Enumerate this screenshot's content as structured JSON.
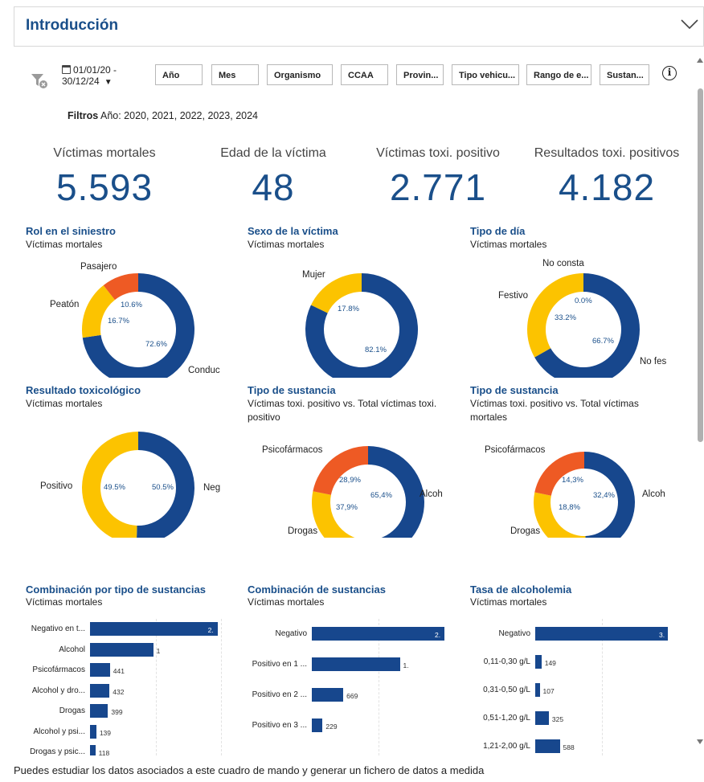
{
  "accordion": {
    "title": "Introducción",
    "chevron_icon": "chevron-down-icon"
  },
  "toolbar": {
    "filter_icon": "filter-clear-icon",
    "date_line1": "01/01/20 -",
    "date_line2": "30/12/24",
    "slicers": [
      "Año",
      "Mes",
      "Organismo",
      "CCAA",
      "Provin...",
      "Tipo vehicu...",
      "Rango de e...",
      "Sustan..."
    ],
    "info_icon": "info-icon"
  },
  "filters": {
    "label": "Filtros",
    "text": "Año: 2020, 2021, 2022, 2023, 2024"
  },
  "kpis": [
    {
      "label": "Víctimas mortales",
      "value": "5.593"
    },
    {
      "label": "Edad de la víctima",
      "value": "48"
    },
    {
      "label": "Víctimas toxi. positivo",
      "value": "2.771"
    },
    {
      "label": "Resultados toxi. positivos",
      "value": "4.182"
    }
  ],
  "colors": {
    "blue": "#17478d",
    "yellow": "#fcc300",
    "orange": "#ee5a24",
    "title_blue": "#1a4f8a"
  },
  "chart_data": [
    {
      "type": "pie",
      "title": "Rol en el siniestro",
      "subtitle": "Víctimas mortales",
      "slices": [
        {
          "name": "Conduc",
          "value": 72.6,
          "color": "#17478d",
          "pct_label": "72.6%"
        },
        {
          "name": "Peatón",
          "value": 16.7,
          "color": "#fcc300",
          "pct_label": "16.7%"
        },
        {
          "name": "Pasajero",
          "value": 10.6,
          "color": "#ee5a24",
          "pct_label": "10.6%"
        }
      ]
    },
    {
      "type": "pie",
      "title": "Sexo de la víctima",
      "subtitle": "Víctimas mortales",
      "slices": [
        {
          "name": "",
          "value": 82.1,
          "color": "#17478d",
          "pct_label": "82.1%"
        },
        {
          "name": "Mujer",
          "value": 17.8,
          "color": "#fcc300",
          "pct_label": "17.8%"
        }
      ]
    },
    {
      "type": "pie",
      "title": "Tipo de día",
      "subtitle": "Víctimas mortales",
      "slices": [
        {
          "name": "No fes",
          "value": 66.7,
          "color": "#17478d",
          "pct_label": "66.7%"
        },
        {
          "name": "Festivo",
          "value": 33.2,
          "color": "#fcc300",
          "pct_label": "33.2%"
        },
        {
          "name": "No consta",
          "value": 0.0,
          "color": "#ee5a24",
          "pct_label": "0.0%"
        }
      ]
    },
    {
      "type": "pie",
      "title": "Resultado toxicológico",
      "subtitle": "Víctimas mortales",
      "slices": [
        {
          "name": "Neg",
          "value": 50.5,
          "color": "#17478d",
          "pct_label": "50.5%"
        },
        {
          "name": "Positivo",
          "value": 49.5,
          "color": "#fcc300",
          "pct_label": "49.5%"
        }
      ]
    },
    {
      "type": "pie",
      "title": "Tipo de sustancia",
      "subtitle": "Víctimas toxi. positivo vs. Total víctimas toxi. positivo",
      "slices": [
        {
          "name": "Alcoh",
          "value": 65.4,
          "color": "#17478d",
          "pct_label": "65,4%"
        },
        {
          "name": "Drogas",
          "value": 37.9,
          "color": "#fcc300",
          "pct_label": "37,9%"
        },
        {
          "name": "Psicofármacos",
          "value": 28.9,
          "color": "#ee5a24",
          "pct_label": "28,9%"
        }
      ]
    },
    {
      "type": "pie",
      "title": "Tipo de sustancia",
      "subtitle": "Víctimas toxi. positivo vs. Total víctimas mortales",
      "slices": [
        {
          "name": "Alcoh",
          "value": 32.4,
          "color": "#17478d",
          "pct_label": "32,4%"
        },
        {
          "name": "Drogas",
          "value": 18.8,
          "color": "#fcc300",
          "pct_label": "18,8%"
        },
        {
          "name": "Psicofármacos",
          "value": 14.3,
          "color": "#ee5a24",
          "pct_label": "14,3%"
        }
      ]
    },
    {
      "type": "bar",
      "title": "Combinación por tipo de sustancias",
      "subtitle": "Víctimas mortales",
      "categories": [
        "Negativo en t...",
        "Alcohol",
        "Psicofármacos",
        "Alcohol y dro...",
        "Drogas",
        "Alcohol y psi...",
        "Drogas y psic..."
      ],
      "values": [
        2822,
        1399,
        441,
        432,
        399,
        139,
        118
      ],
      "value_labels": [
        "2.",
        "1",
        "441",
        "432",
        "399",
        "139",
        "118"
      ]
    },
    {
      "type": "bar",
      "title": "Combinación de sustancias",
      "subtitle": "Víctimas mortales",
      "categories": [
        "Negativo",
        "Positivo en 1 ...",
        "Positivo en 2 ...",
        "Positivo en 3 ..."
      ],
      "values": [
        2822,
        1873,
        669,
        229
      ],
      "value_labels": [
        "2.",
        "1.",
        "669",
        "229"
      ]
    },
    {
      "type": "bar",
      "title": "Tasa de alcoholemia",
      "subtitle": "Víctimas mortales",
      "categories": [
        "Negativo",
        "0,11-0,30 g/L",
        "0,31-0,50 g/L",
        "0,51-1,20 g/L",
        "1,21-2,00 g/L"
      ],
      "values": [
        3200,
        149,
        107,
        325,
        588
      ],
      "value_labels": [
        "3.",
        "149",
        "107",
        "325",
        "588"
      ]
    }
  ],
  "footer": {
    "text": "Puedes estudiar los datos asociados a este cuadro de mando y generar un fichero de datos a medida"
  }
}
